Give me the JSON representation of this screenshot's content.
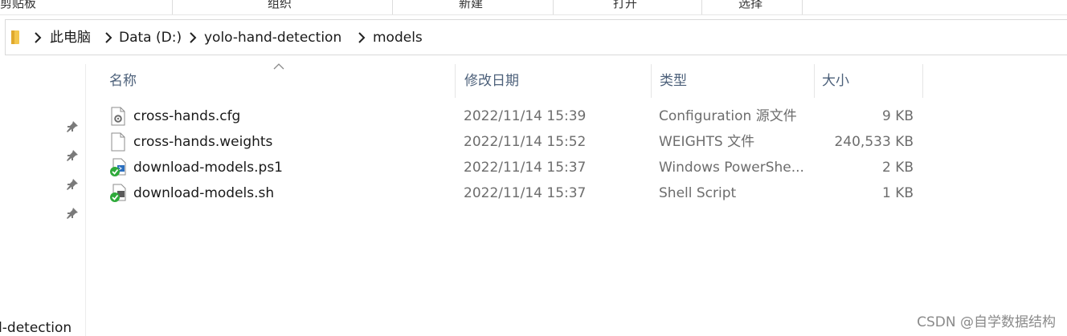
{
  "ribbon": {
    "groups": [
      "剪贴板",
      "组织",
      "新建",
      "打开",
      "选择"
    ]
  },
  "address_bar": {
    "breadcrumbs": [
      "此电脑",
      "Data (D:)",
      "yolo-hand-detection",
      "models"
    ]
  },
  "nav_pane": {
    "partial_item_label": "d-detection"
  },
  "columns": {
    "name": "名称",
    "modified": "修改日期",
    "type": "类型",
    "size": "大小"
  },
  "files": [
    {
      "name": "cross-hands.cfg",
      "modified": "2022/11/14 15:39",
      "type": "Configuration 源文件",
      "size": "9 KB",
      "icon": "config-file-icon"
    },
    {
      "name": "cross-hands.weights",
      "modified": "2022/11/14 15:52",
      "type": "WEIGHTS 文件",
      "size": "240,533 KB",
      "icon": "blank-file-icon"
    },
    {
      "name": "download-models.ps1",
      "modified": "2022/11/14 15:37",
      "type": "Windows PowerShe...",
      "size": "2 KB",
      "icon": "powershell-script-icon"
    },
    {
      "name": "download-models.sh",
      "modified": "2022/11/14 15:37",
      "type": "Shell Script",
      "size": "1 KB",
      "icon": "shell-script-icon"
    }
  ],
  "watermark": "CSDN @自学数据结构",
  "colors": {
    "header_text": "#4c607a",
    "muted_text": "#6d6d6d",
    "sync_green": "#2eaa3a",
    "folder_yellow": "#f3c64d"
  }
}
